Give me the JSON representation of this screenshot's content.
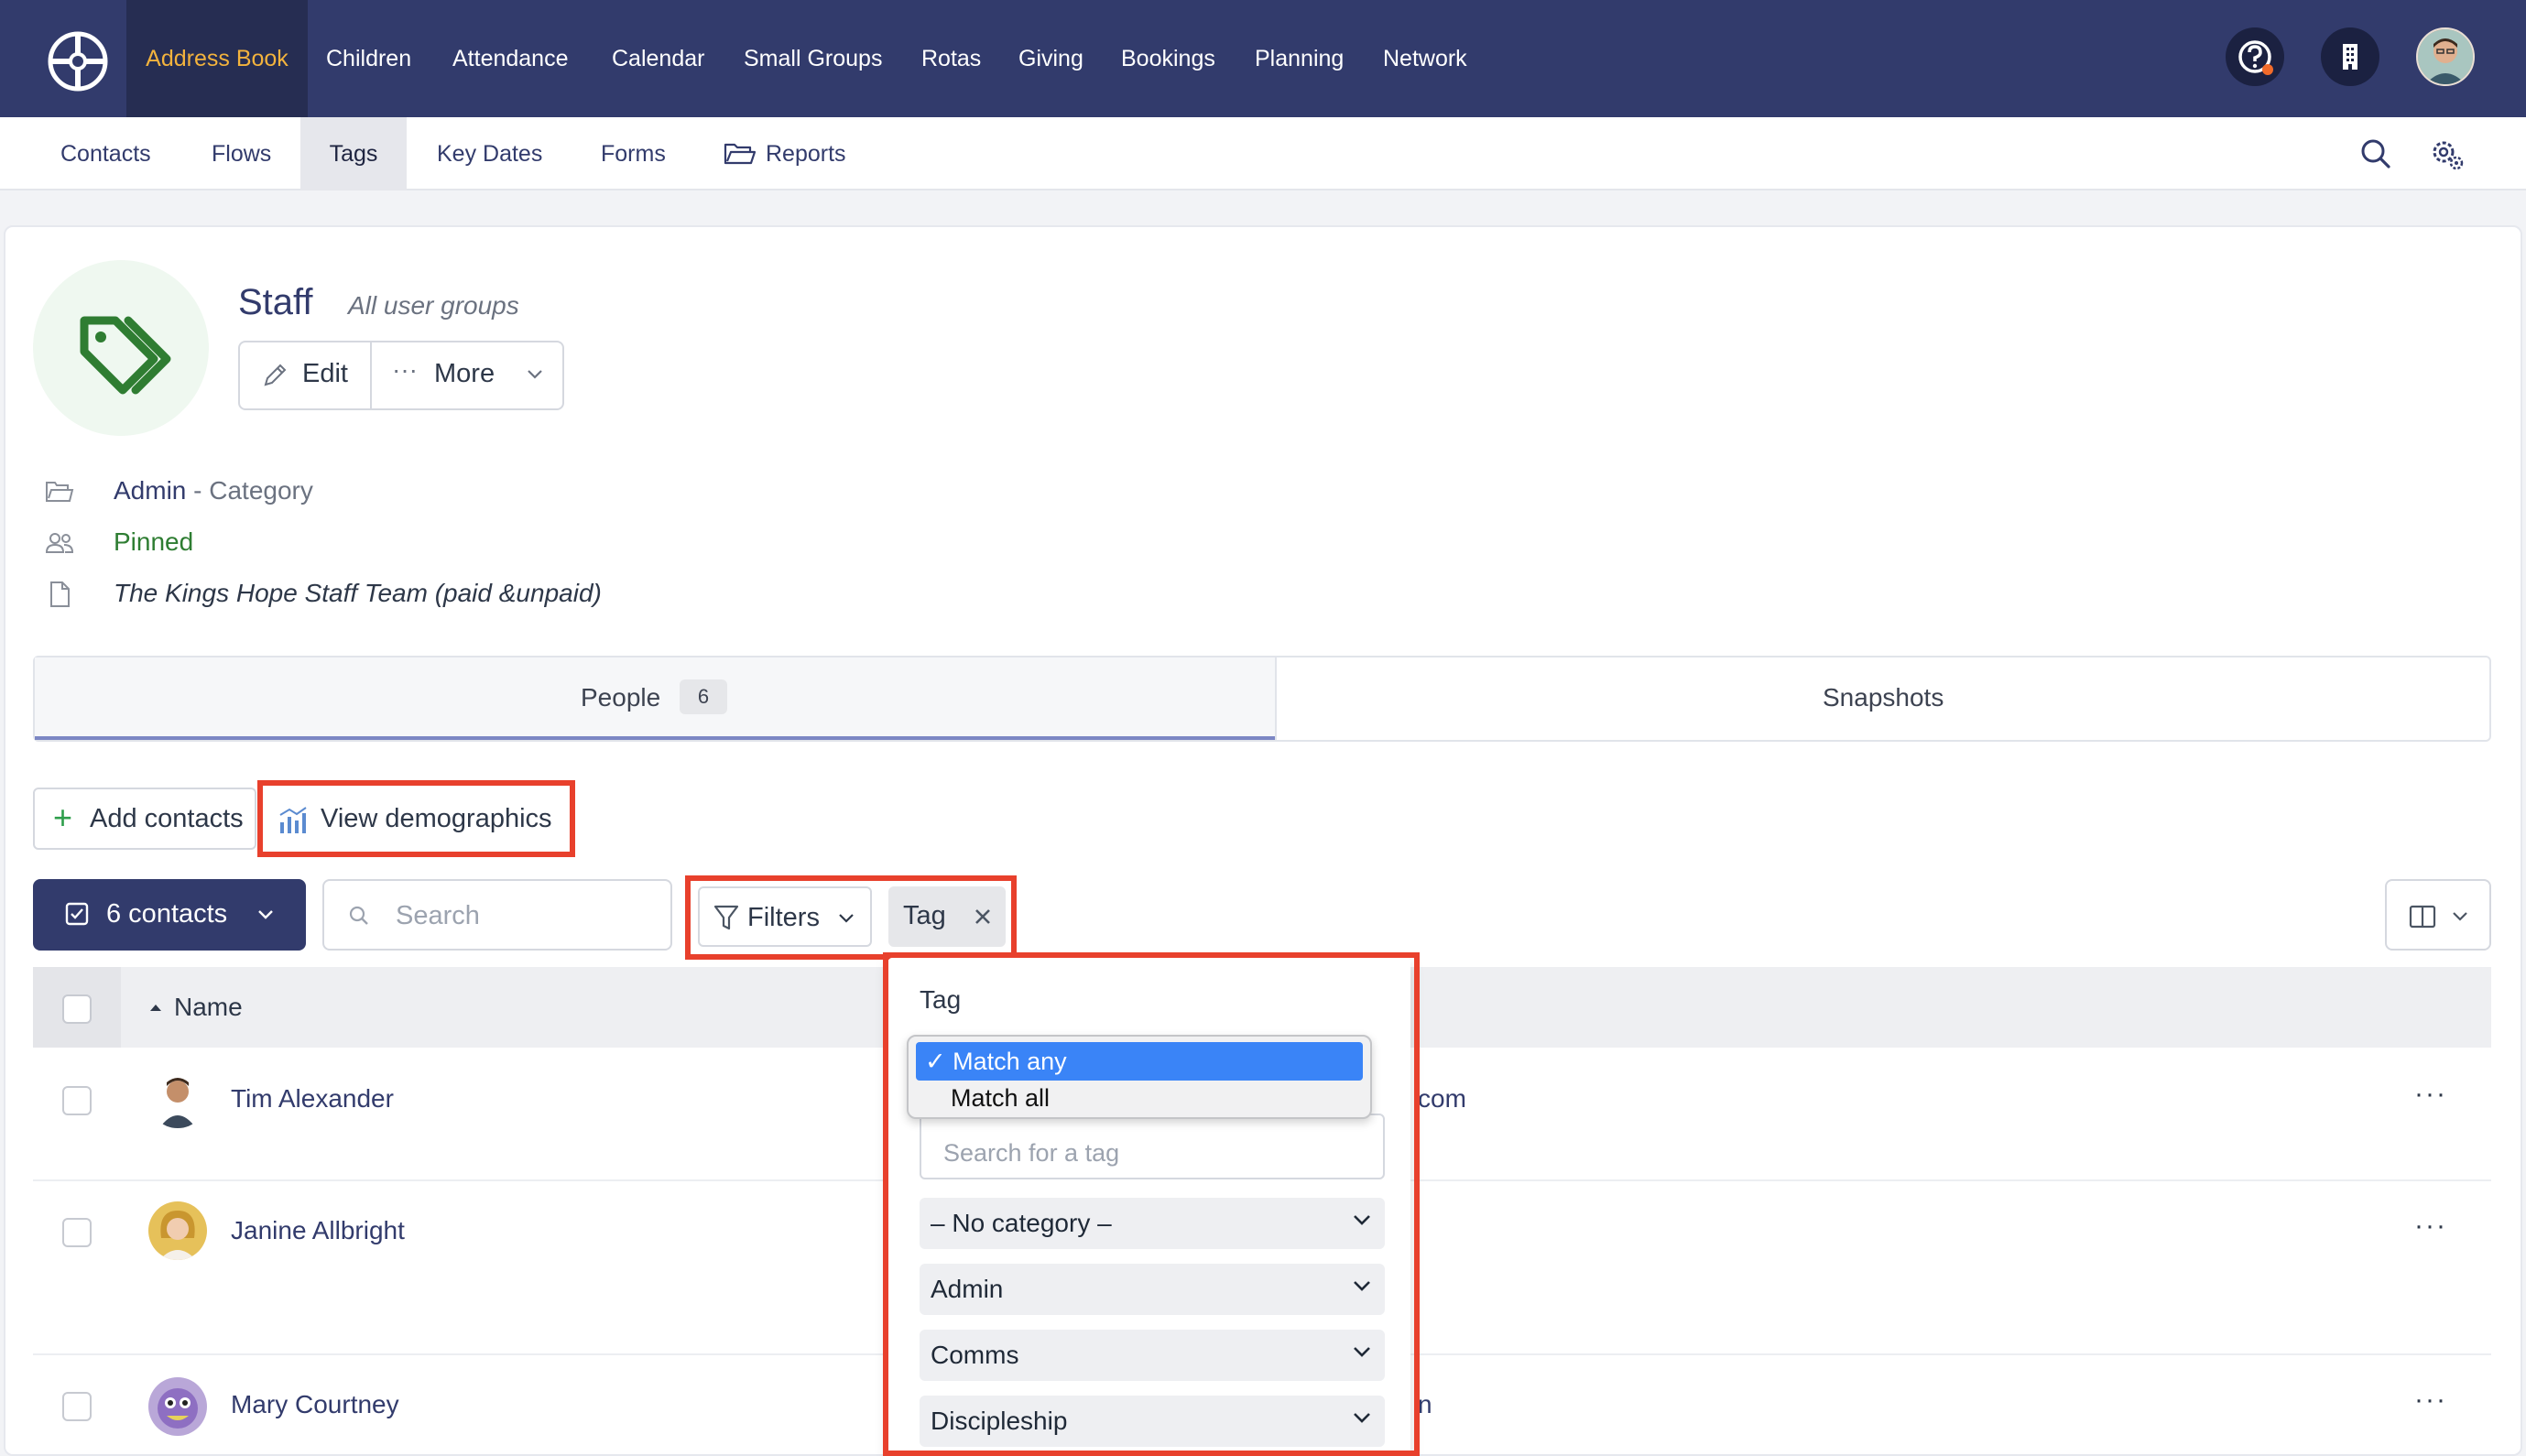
{
  "topnav": {
    "items": [
      {
        "label": "Address Book",
        "active": true
      },
      {
        "label": "Children"
      },
      {
        "label": "Attendance"
      },
      {
        "label": "Calendar"
      },
      {
        "label": "Small Groups"
      },
      {
        "label": "Rotas"
      },
      {
        "label": "Giving"
      },
      {
        "label": "Bookings"
      },
      {
        "label": "Planning"
      },
      {
        "label": "Network"
      }
    ],
    "icons": [
      "help-icon",
      "organisation-icon",
      "user-avatar"
    ]
  },
  "subnav": {
    "items": [
      {
        "label": "Contacts"
      },
      {
        "label": "Flows"
      },
      {
        "label": "Tags",
        "active": true
      },
      {
        "label": "Key Dates"
      },
      {
        "label": "Forms"
      },
      {
        "label": "Reports",
        "icon": "folder-open-icon"
      }
    ],
    "icons": [
      "search-icon",
      "settings-icon"
    ]
  },
  "tag": {
    "name": "Staff",
    "scope": "All user groups",
    "edit_label": "Edit",
    "more_label": "More",
    "category_name": "Admin",
    "category_suffix": " - Category",
    "pinned_label": "Pinned",
    "description": "The Kings Hope Staff Team (paid &unpaid)"
  },
  "tabs": {
    "people_label": "People",
    "people_count": "6",
    "snapshots_label": "Snapshots"
  },
  "actions": {
    "add_contacts": "Add contacts",
    "view_demographics": "View demographics",
    "contacts_selector": "6 contacts",
    "search_placeholder": "Search",
    "filters_label": "Filters",
    "tag_chip": "Tag"
  },
  "table": {
    "name_header": "Name",
    "rows": [
      {
        "name": "Tim Alexander",
        "email_fragment": "com"
      },
      {
        "name": "Janine Allbright",
        "email_fragment": ""
      },
      {
        "name": "Mary Courtney",
        "email_fragment": "n"
      }
    ]
  },
  "filter_panel": {
    "title": "Tag",
    "match_options": [
      {
        "label": "✓ Match any",
        "selected": true
      },
      {
        "label": "Match all",
        "selected": false
      }
    ],
    "search_placeholder": "Search for a tag",
    "categories": [
      "– No category –",
      "Admin",
      "Comms",
      "Discipleship"
    ]
  },
  "colors": {
    "nav_bg": "#323b6c",
    "active_nav_text": "#f3b33d",
    "highlight_red": "#e8402c",
    "selection_blue": "#3a84f7",
    "pinned_green": "#2e7d32"
  }
}
